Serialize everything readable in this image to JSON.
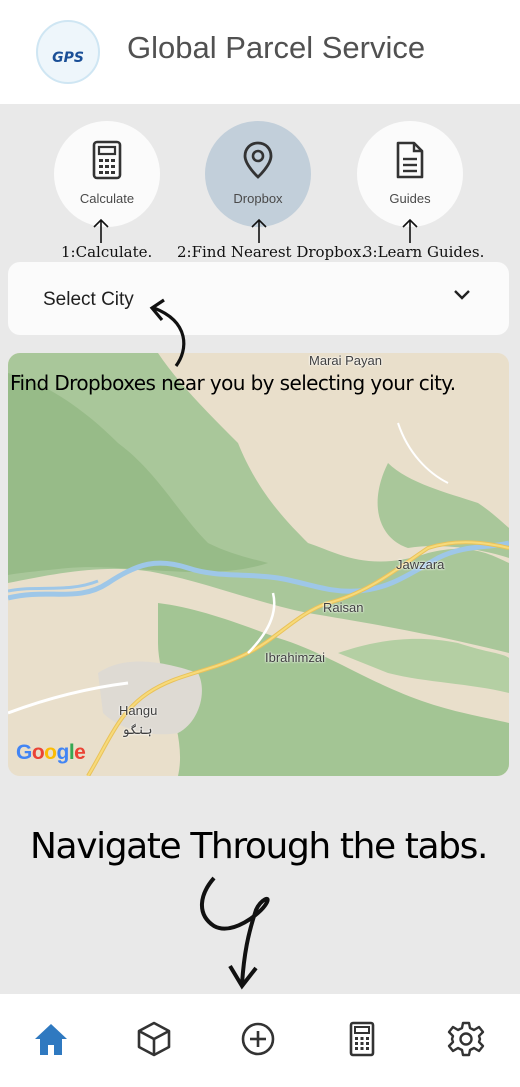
{
  "app": {
    "title": "Global Parcel Service",
    "logo_text": "GPS"
  },
  "actions": [
    {
      "label": "Calculate",
      "icon": "calculator-icon"
    },
    {
      "label": "Dropbox",
      "icon": "location-pin-icon",
      "active": true
    },
    {
      "label": "Guides",
      "icon": "document-icon"
    }
  ],
  "annotations": {
    "step1": "1:Calculate.",
    "step2": "2:Find Nearest Dropbox.",
    "step3": "3:Learn Guides.",
    "find_dropboxes": "Find Dropboxes near you by selecting your city.",
    "navigate": "Navigate Through the tabs."
  },
  "city_select": {
    "label": "Select City",
    "icon": "chevron-down-icon"
  },
  "map": {
    "labels": {
      "marai_payan": "Marai Payan",
      "jawzara": "Jawzara",
      "raisan": "Raisan",
      "ibrahimzai": "Ibrahimzai",
      "hangu": "Hangu",
      "hangu_urdu": "ہنگو"
    },
    "attribution": "Google"
  },
  "tabbar": [
    {
      "name": "home",
      "icon": "home-icon",
      "active": true
    },
    {
      "name": "parcel",
      "icon": "box-icon"
    },
    {
      "name": "add",
      "icon": "plus-circle-icon"
    },
    {
      "name": "calculator",
      "icon": "calculator-icon"
    },
    {
      "name": "settings",
      "icon": "gear-icon"
    }
  ],
  "colors": {
    "accent": "#2f79c0",
    "active_circle": "#c2cfda",
    "background": "#e9e9e9"
  }
}
